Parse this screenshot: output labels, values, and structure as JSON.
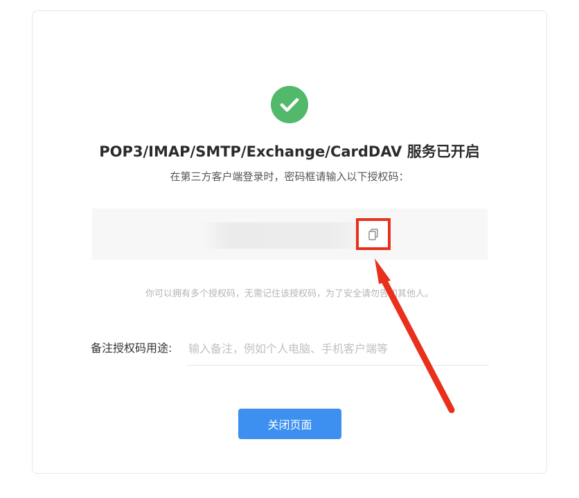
{
  "status": {
    "icon": "check-circle-icon",
    "color": "#52b96b",
    "title": "POP3/IMAP/SMTP/Exchange/CardDAV 服务已开启",
    "subtitle": "在第三方客户端登录时，密码框请输入以下授权码："
  },
  "auth_code": {
    "value": "",
    "copy_icon": "copy-icon",
    "highlight_color": "#e8301c"
  },
  "hint": "你可以拥有多个授权码，无需记住该授权码，为了安全请勿告知其他人。",
  "note": {
    "label": "备注授权码用途:",
    "placeholder": "输入备注，例如个人电脑、手机客户端等",
    "value": ""
  },
  "close_button": {
    "label": "关闭页面",
    "color": "#3d8ff0"
  },
  "annotation": {
    "icon": "red-arrow",
    "color": "#e8301c"
  }
}
